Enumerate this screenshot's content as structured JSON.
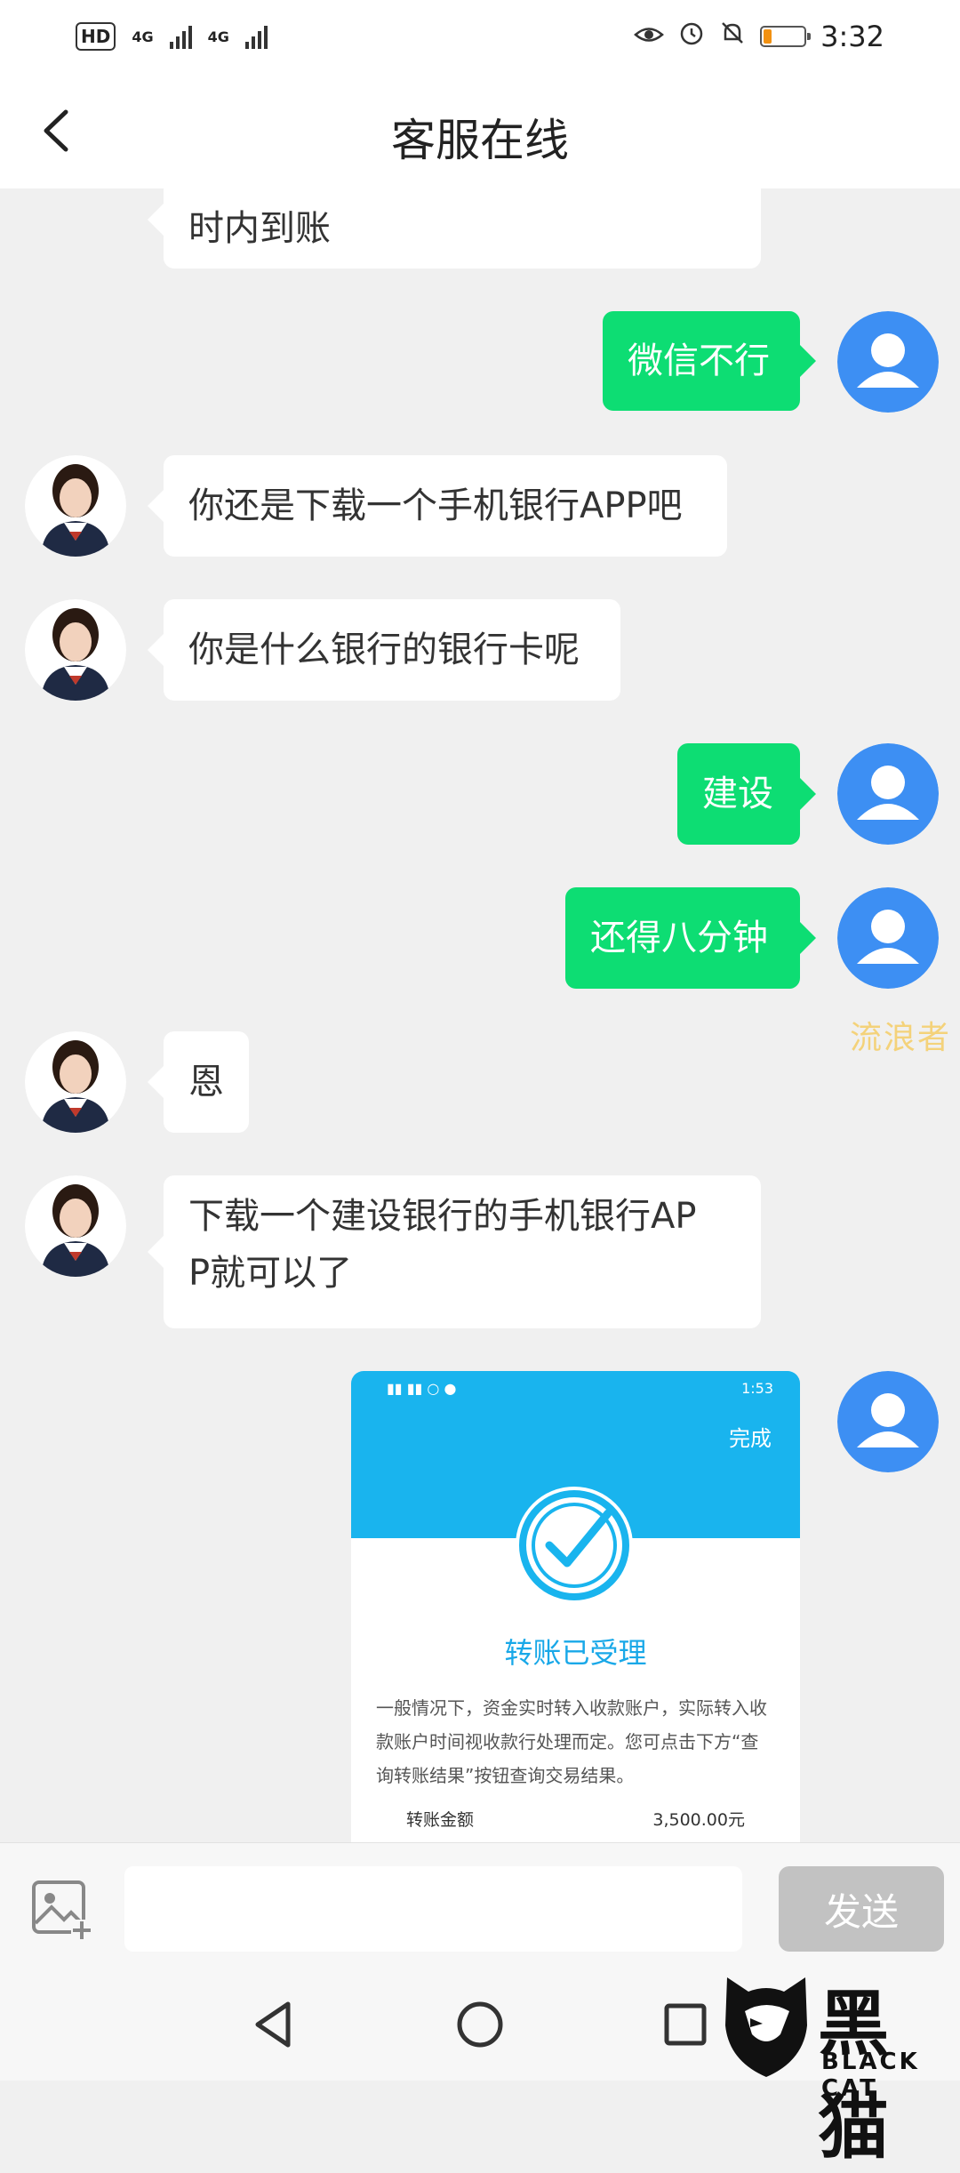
{
  "status_bar": {
    "hd_badge": "HD",
    "sim1_network": "4G",
    "sim2_network": "4G",
    "time": "3:32",
    "battery_level": 0.2
  },
  "header": {
    "title": "客服在线"
  },
  "messages": [
    {
      "sender": "agent",
      "text": "时内到账"
    },
    {
      "sender": "user",
      "text": "微信不行"
    },
    {
      "sender": "agent",
      "text": "你还是下载一个手机银行APP吧"
    },
    {
      "sender": "agent",
      "text": "你是什么银行的银行卡呢"
    },
    {
      "sender": "user",
      "text": "建设"
    },
    {
      "sender": "user",
      "text": "还得八分钟"
    },
    {
      "sender": "agent",
      "text": "恩"
    },
    {
      "sender": "agent",
      "line1": "下载一个建设银行的手机银行AP",
      "line2": "P就可以了"
    },
    {
      "sender": "user",
      "type": "image"
    }
  ],
  "watermark": "流浪者",
  "shared_screenshot": {
    "time": "1:53",
    "done_label": "完成",
    "title": "转账已受理",
    "description": "一般情况下，资金实时转入收款账户，实际转入收款账户时间视收款行处理而定。您可点击下方“查询转账结果”按钮查询交易结果。",
    "amount_label": "转账金额",
    "amount_value": "3,500.00元"
  },
  "input_bar": {
    "placeholder": "",
    "send_label": "发送"
  },
  "logo": {
    "cn": "黑猫",
    "en": "BLACK CAT"
  },
  "colors": {
    "user_bubble": "#0ddd73",
    "agent_bubble": "#ffffff",
    "chat_background": "#f0f0f0",
    "user_avatar": "#3d8ff3",
    "send_button": "#c2c2c2",
    "receipt_accent": "#19b4ee"
  }
}
